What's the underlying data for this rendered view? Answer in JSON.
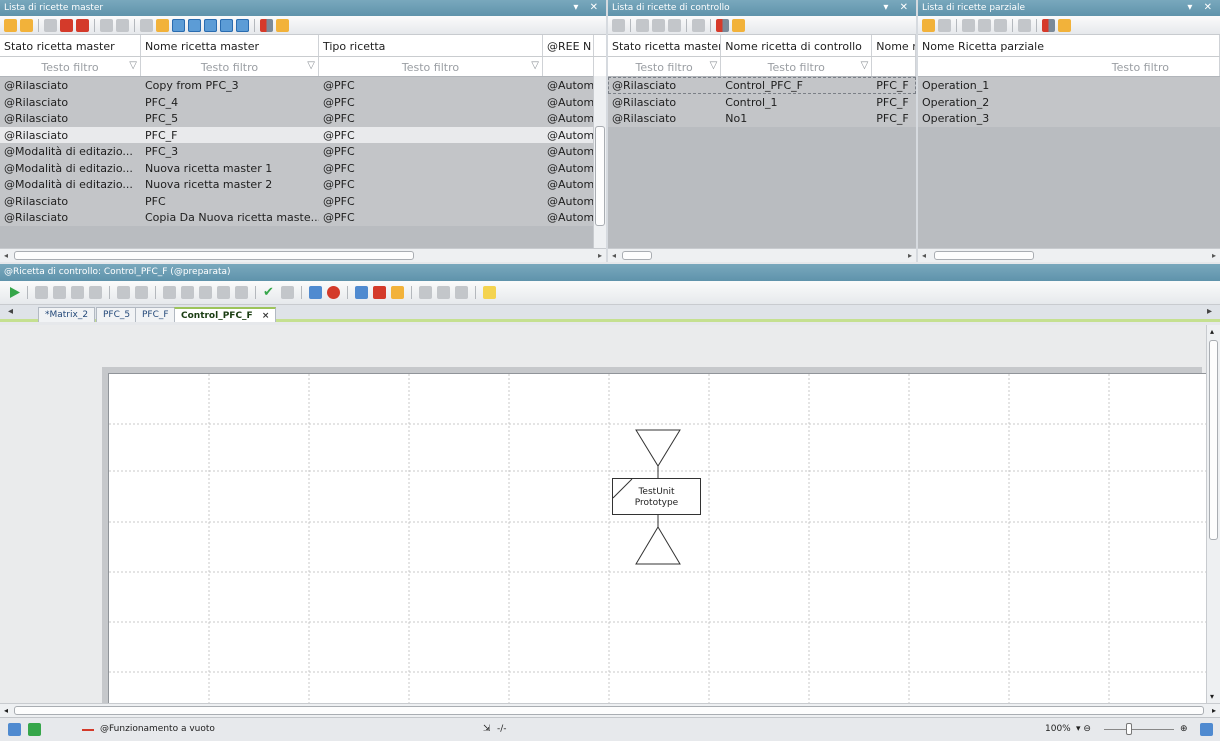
{
  "master_pane": {
    "title": "Lista di ricette master",
    "controls": "▾ ✕",
    "columns": [
      "Stato ricetta master",
      "Nome ricetta master",
      "Tipo ricetta",
      "@REE N"
    ],
    "filter_placeholder": "Testo filtro",
    "rows": [
      [
        "@Rilasciato",
        "Copy from PFC_3",
        "@PFC",
        "@Autom"
      ],
      [
        "@Rilasciato",
        "PFC_4",
        "@PFC",
        "@Autom"
      ],
      [
        "@Rilasciato",
        "PFC_5",
        "@PFC",
        "@Autom"
      ],
      [
        "@Rilasciato",
        "PFC_F",
        "@PFC",
        "@Autom"
      ],
      [
        "@Modalità di editazio...",
        "PFC_3",
        "@PFC",
        "@Autom"
      ],
      [
        "@Modalità di editazio...",
        "Nuova ricetta master 1",
        "@PFC",
        "@Autom"
      ],
      [
        "@Modalità di editazio...",
        "Nuova ricetta master 2",
        "@PFC",
        "@Autom"
      ],
      [
        "@Rilasciato",
        "PFC",
        "@PFC",
        "@Autom"
      ],
      [
        "@Rilasciato",
        "Copia Da Nuova ricetta maste...",
        "@PFC",
        "@Autom"
      ]
    ]
  },
  "control_pane": {
    "title": "Lista di ricette di controllo",
    "controls": "▾ ✕",
    "columns": [
      "Stato ricetta master",
      "Nome ricetta di controllo",
      "Nome r"
    ],
    "filter_placeholder": "Testo filtro",
    "rows": [
      [
        "@Rilasciato",
        "Control_PFC_F",
        "PFC_F"
      ],
      [
        "@Rilasciato",
        "Control_1",
        "PFC_F"
      ],
      [
        "@Rilasciato",
        "No1",
        "PFC_F"
      ]
    ]
  },
  "partial_pane": {
    "title": "Lista di ricette parziale",
    "controls": "▾ ✕",
    "columns": [
      "Nome Ricetta parziale"
    ],
    "filter_placeholder": "Testo filtro",
    "rows": [
      [
        "Operation_1"
      ],
      [
        "Operation_2"
      ],
      [
        "Operation_3"
      ]
    ]
  },
  "editor": {
    "title": "@Ricetta di controllo: Control_PFC_F (@preparata)",
    "tabs": [
      "*Matrix_2",
      "PFC_5",
      "PFC_F",
      "Control_PFC_F"
    ],
    "tab_close": "×",
    "node_label_1": "TestUnit",
    "node_label_2": "Prototype"
  },
  "status": {
    "mode": "@Funzionamento a vuoto",
    "position": "-/-",
    "zoom": "100%"
  },
  "colors": {
    "title_bar": "#6a9cb4",
    "grid_bg": "#c3c5c8",
    "active_tab_accent": "#9cc45a"
  }
}
